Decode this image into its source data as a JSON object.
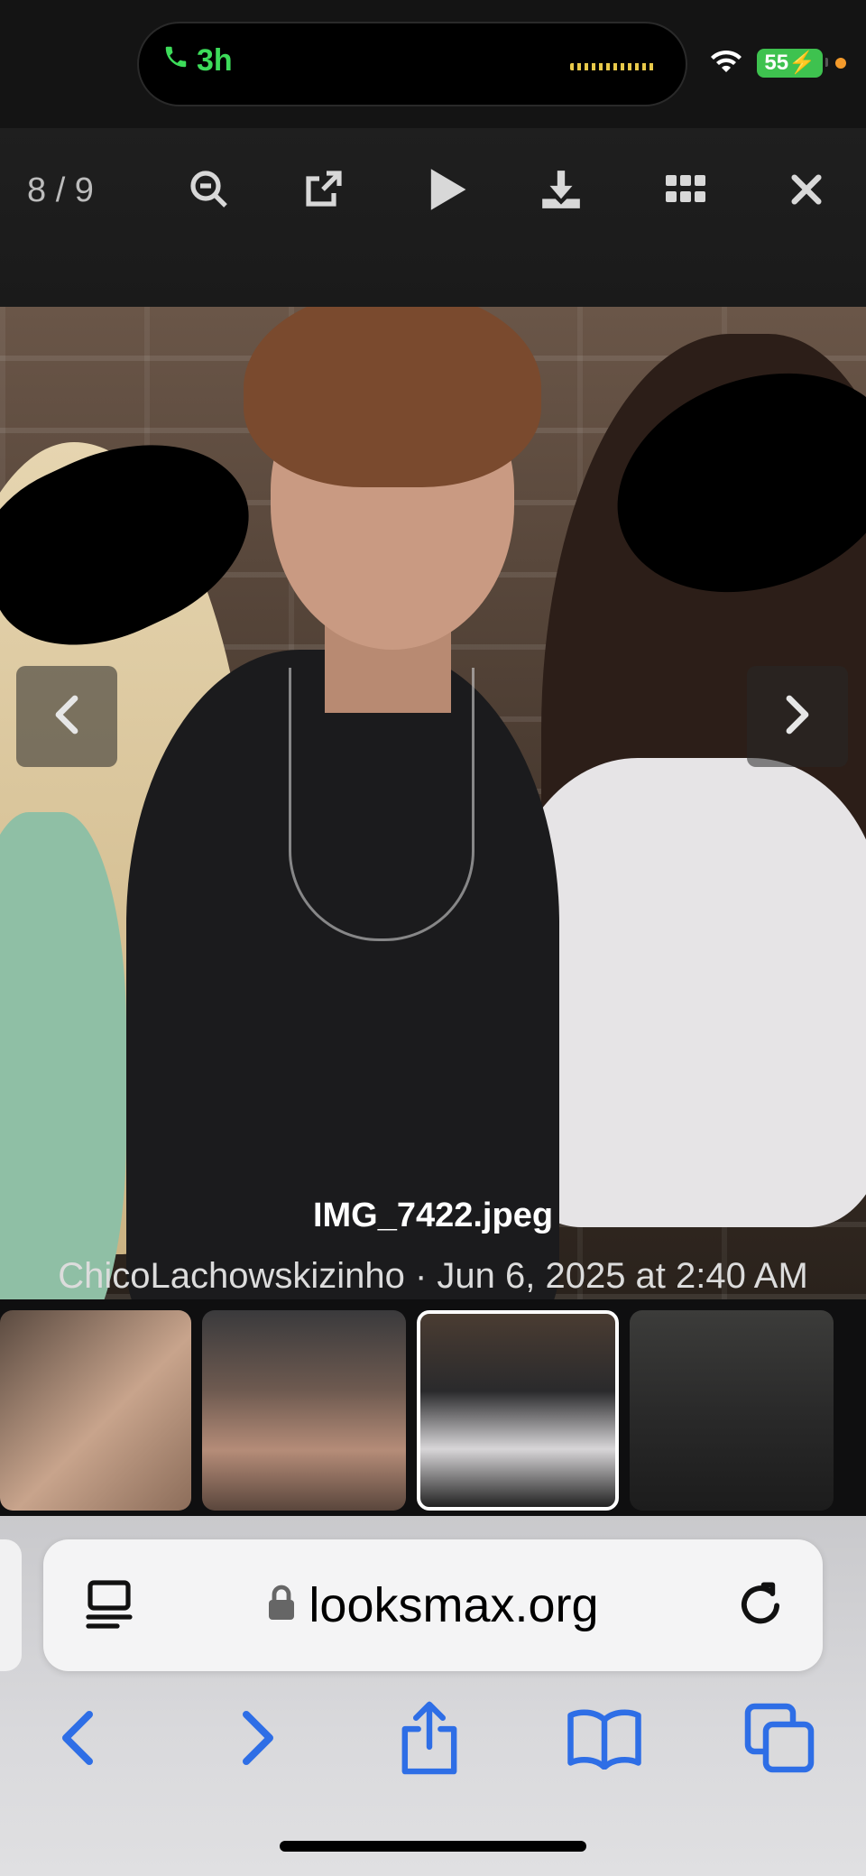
{
  "status_bar": {
    "call_duration": "3h",
    "battery": "55"
  },
  "toolbar": {
    "counter": "8 / 9"
  },
  "photo": {
    "filename": "IMG_7422.jpeg",
    "meta": "ChicoLachowskizinho · Jun 6, 2025 at 2:40 AM"
  },
  "browser": {
    "url": "looksmax.org"
  },
  "colors": {
    "accent_blue": "#2e6ee6",
    "call_green": "#3ddc5a",
    "battery_green": "#3ec24f"
  }
}
